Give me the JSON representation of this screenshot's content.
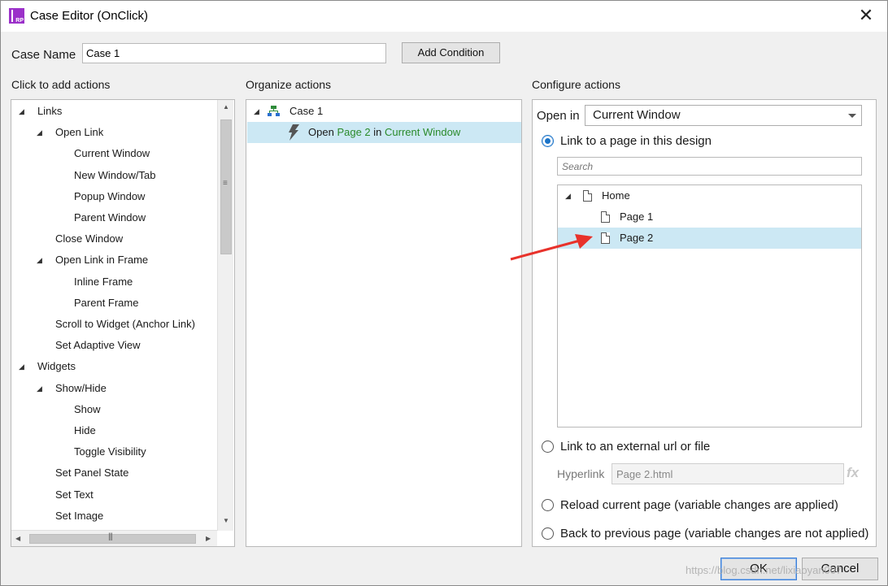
{
  "window": {
    "title": "Case Editor (OnClick)",
    "app_icon_text": "RP"
  },
  "case_name": {
    "label": "Case Name",
    "value": "Case 1"
  },
  "add_condition_label": "Add Condition",
  "columns": {
    "add_actions": "Click to add actions",
    "organize": "Organize actions",
    "configure": "Configure actions"
  },
  "actions_tree": [
    {
      "label": "Links",
      "level": 0,
      "expanded": true
    },
    {
      "label": "Open Link",
      "level": 1,
      "expanded": true
    },
    {
      "label": "Current Window",
      "level": 2
    },
    {
      "label": "New Window/Tab",
      "level": 2
    },
    {
      "label": "Popup Window",
      "level": 2
    },
    {
      "label": "Parent Window",
      "level": 2
    },
    {
      "label": "Close Window",
      "level": 1
    },
    {
      "label": "Open Link in Frame",
      "level": 1,
      "expanded": true
    },
    {
      "label": "Inline Frame",
      "level": 2
    },
    {
      "label": "Parent Frame",
      "level": 2
    },
    {
      "label": "Scroll to Widget (Anchor Link)",
      "level": 1
    },
    {
      "label": "Set Adaptive View",
      "level": 1
    },
    {
      "label": "Widgets",
      "level": 0,
      "expanded": true
    },
    {
      "label": "Show/Hide",
      "level": 1,
      "expanded": true
    },
    {
      "label": "Show",
      "level": 2
    },
    {
      "label": "Hide",
      "level": 2
    },
    {
      "label": "Toggle Visibility",
      "level": 2
    },
    {
      "label": "Set Panel State",
      "level": 1
    },
    {
      "label": "Set Text",
      "level": 1
    },
    {
      "label": "Set Image",
      "level": 1
    }
  ],
  "organize": {
    "case_label": "Case 1",
    "action": {
      "verb": "Open",
      "target": "Page 2",
      "joiner": "in",
      "where": "Current Window"
    }
  },
  "configure": {
    "open_in_label": "Open in",
    "open_in_value": "Current Window",
    "radio_link_page": "Link to a page in this design",
    "search_placeholder": "Search",
    "pages": [
      {
        "label": "Home",
        "level": 0
      },
      {
        "label": "Page 1",
        "level": 1
      },
      {
        "label": "Page 2",
        "level": 1,
        "selected": true
      }
    ],
    "radio_external": "Link to an external url or file",
    "hyperlink_label": "Hyperlink",
    "hyperlink_value": "Page 2.html",
    "fx_label": "fx",
    "radio_reload": "Reload current page (variable changes are applied)",
    "radio_back": "Back to previous page (variable changes are not applied)"
  },
  "buttons": {
    "ok": "OK",
    "cancel": "Cancel"
  },
  "watermark": "https://blog.csdn.net/lixiaoyan007",
  "colors": {
    "selection": "#cce8f4",
    "link_green": "#2a8a2a",
    "accent": "#1a73c8",
    "annotation_arrow": "#e8322b"
  }
}
